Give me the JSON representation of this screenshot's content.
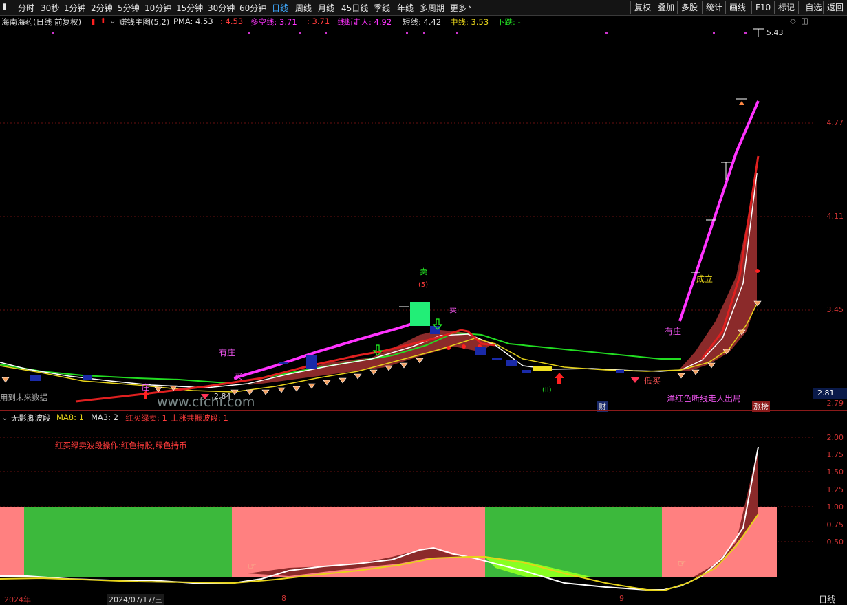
{
  "toolbar": {
    "left_items": [
      "分时",
      "30秒",
      "1分钟",
      "2分钟",
      "5分钟",
      "10分钟",
      "15分钟",
      "30分钟",
      "60分钟",
      "日线",
      "周线",
      "月线",
      "45日线",
      "季线",
      "年线",
      "多周期",
      "更多"
    ],
    "active": "日线",
    "right_items": [
      "复权",
      "叠加",
      "多股",
      "统计",
      "画线",
      "F10",
      "标记",
      "-自选",
      "返回"
    ]
  },
  "main": {
    "stock_title": "海南海药(日线 前复权)",
    "indicator_name": "赚钱主图(5,2)",
    "pma": "PMA: 4.53",
    "pma2": ": 4.53",
    "duokong": "多空线: 3.71",
    "duokong2": ": 3.71",
    "xianduan": "线断走人: 4.92",
    "duanxian": "短线: 4.42",
    "zhongxian": "中线: 3.53",
    "xiadie": "下跌: -",
    "high_label": "5.43",
    "low_label": "2.84",
    "future_note": "用到未来数据",
    "watermark": "www.cfchi.com",
    "annotations": {
      "youzhuang1": "有庄",
      "youzhuang2": "有庄",
      "mai_buy": "买",
      "mai_sell": "卖",
      "mai_sell2": "卖",
      "sell_num": "(5)",
      "chengli": "成立",
      "dimai": "低买",
      "bottom_note": "洋红色断线走人出局",
      "cai": "财",
      "zhangbang": "涨榜",
      "zhuang": "庄",
      "marker_ii": "(II)"
    },
    "y_ticks": [
      "4.77",
      "4.11",
      "3.45",
      "2.79"
    ],
    "current_price": "2.81"
  },
  "sub": {
    "indicator_name": "无影脚波段",
    "ma8": "MA8: 1",
    "ma3": "MA3: 2",
    "hongmai": "红买绿卖: 1",
    "shangzhang": "上涨共振波段: 1",
    "note": "红买绿卖波段操作:红色持股,绿色持币",
    "y_ticks": [
      "2.00",
      "1.75",
      "1.50",
      "1.25",
      "1.00",
      "0.75",
      "0.50"
    ]
  },
  "xaxis": {
    "labels": [
      "2024年",
      "2024/07/17/三",
      "8",
      "9"
    ],
    "period": "日线"
  },
  "colors": {
    "magenta": "#ff33ff",
    "red": "#ff2020",
    "green": "#22dd22",
    "bull_bg": "#ff8080",
    "bear_bg": "#3cb93c",
    "grid": "#7a1010"
  }
}
